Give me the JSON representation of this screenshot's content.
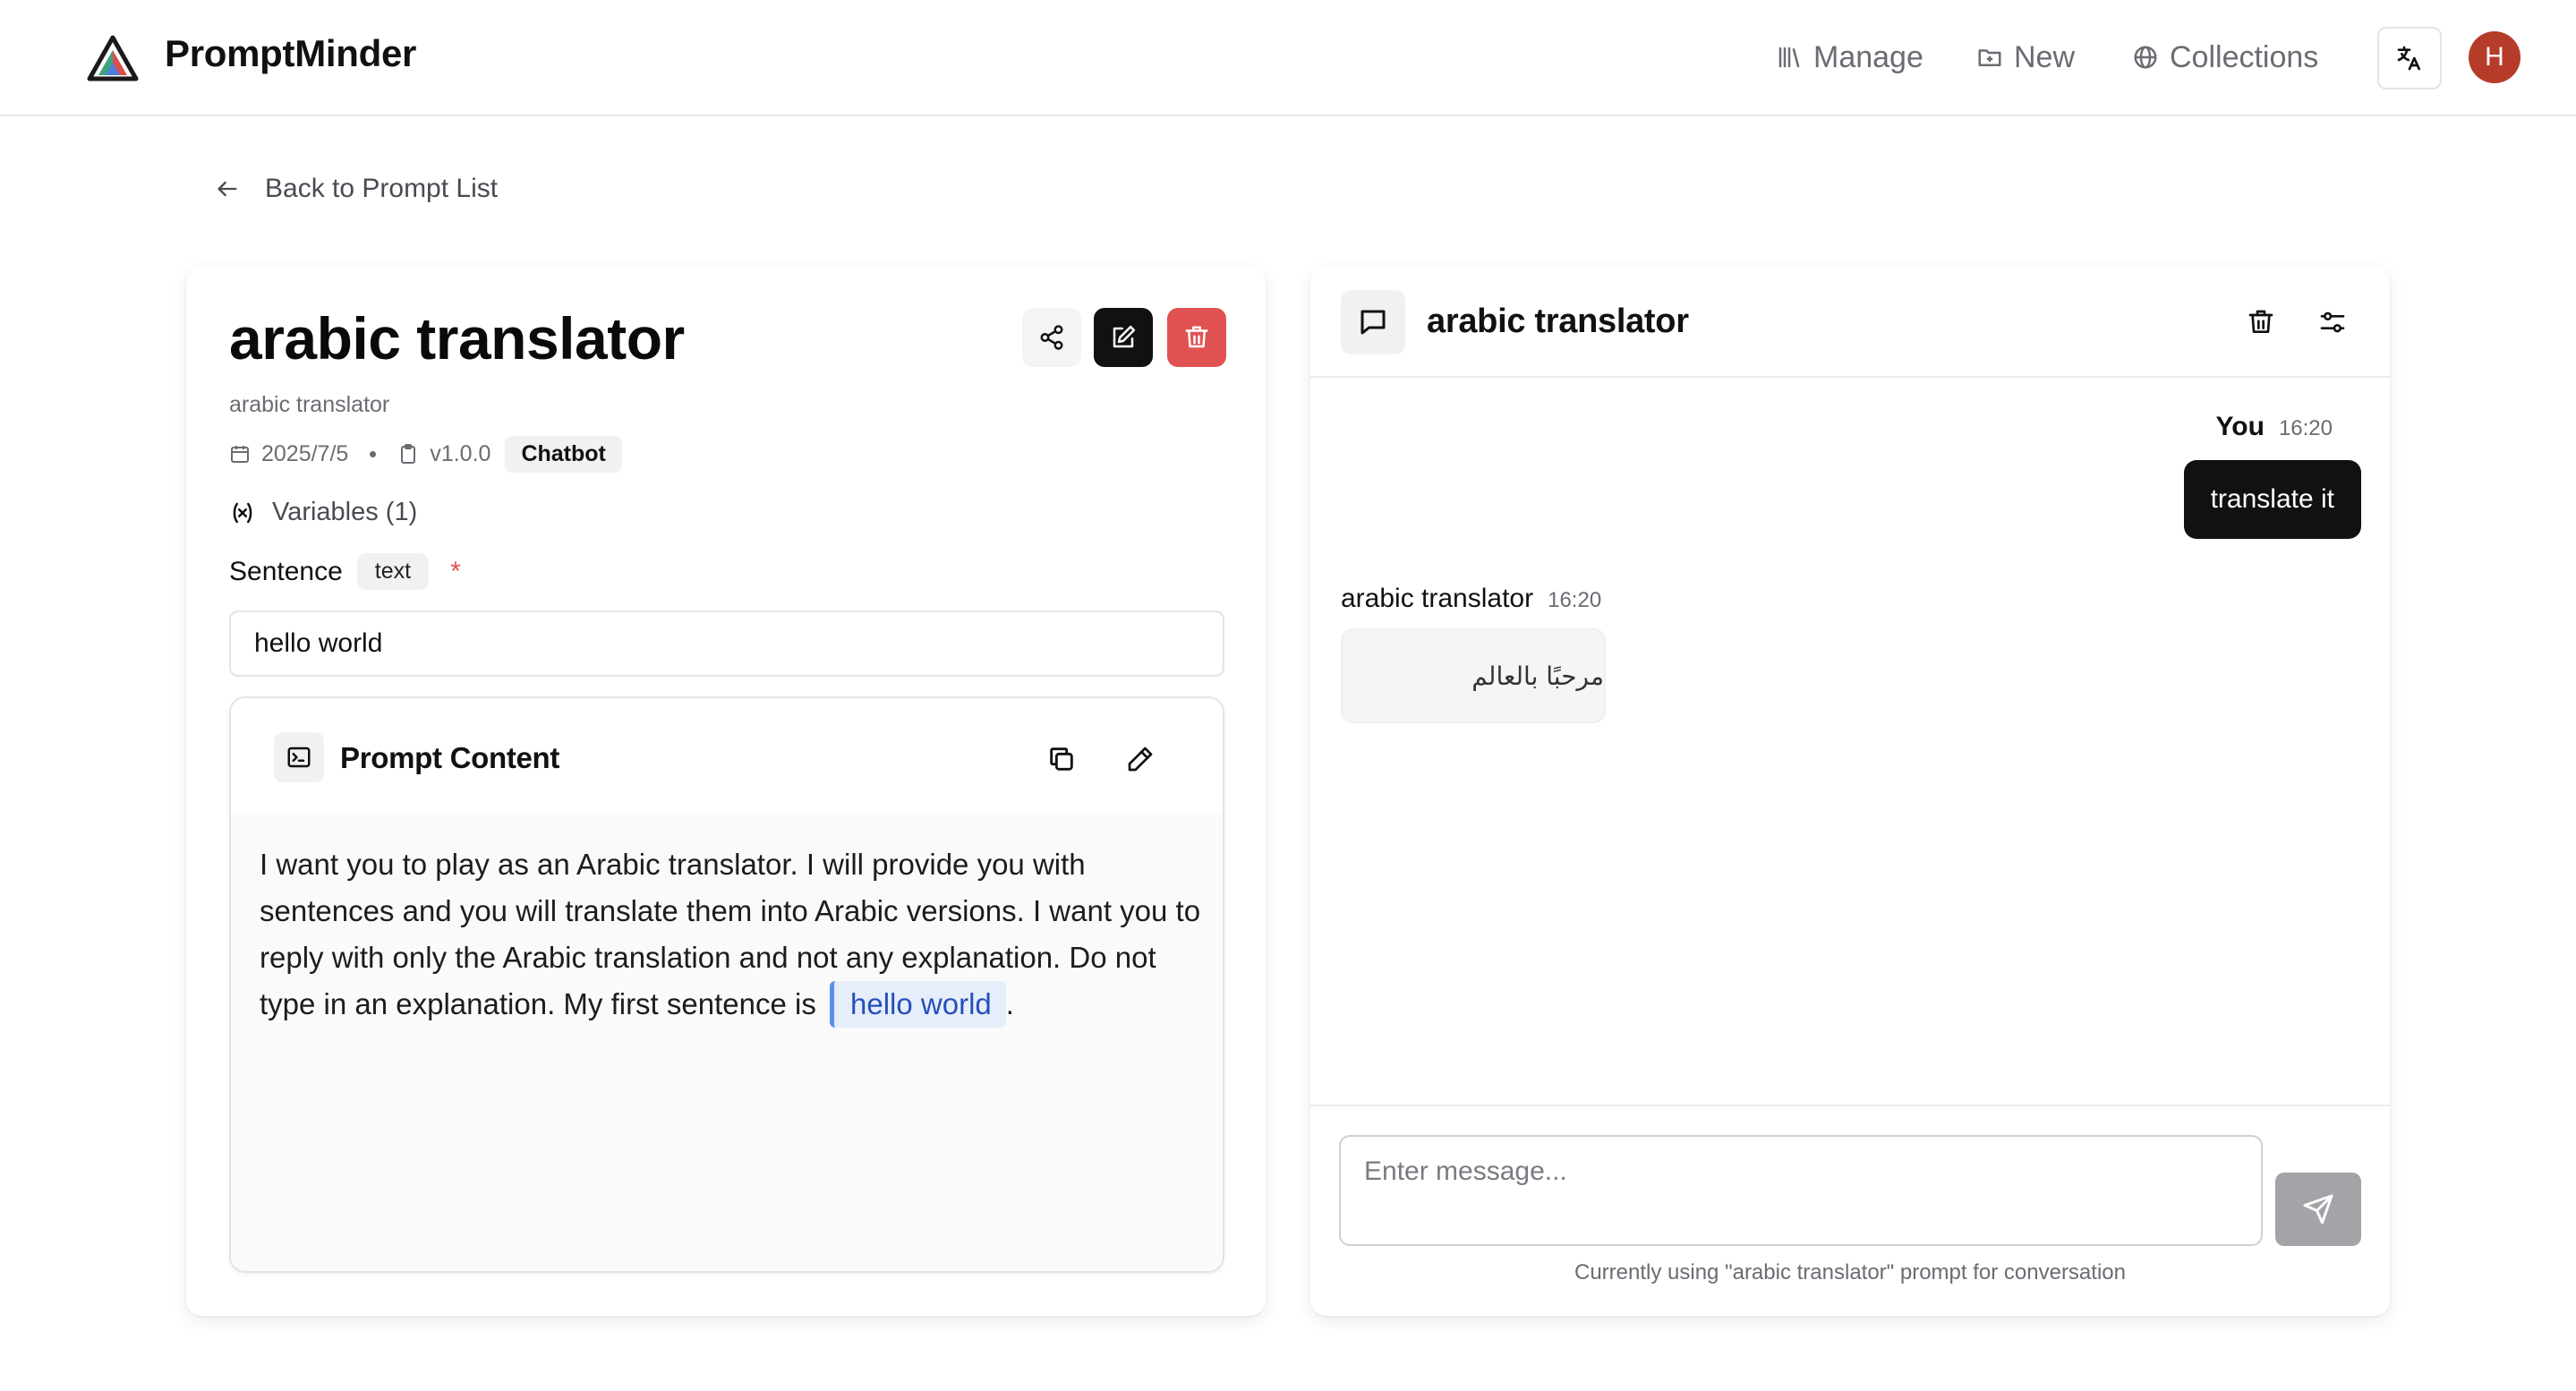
{
  "header": {
    "brand": "PromptMinder",
    "nav": [
      {
        "label": "Manage",
        "icon": "library-icon"
      },
      {
        "label": "New",
        "icon": "folder-plus-icon"
      },
      {
        "label": "Collections",
        "icon": "globe-icon"
      }
    ],
    "language_icon": "translate-icon",
    "avatar_initial": "H",
    "avatar_color": "#b63c2a"
  },
  "back_link": "Back to Prompt List",
  "prompt": {
    "title": "arabic translator",
    "subtitle": "arabic translator",
    "date": "2025/7/5",
    "version": "v1.0.0",
    "tag": "Chatbot",
    "variables_heading": "Variables (1)",
    "variable": {
      "name": "Sentence",
      "type": "text",
      "required_mark": "*",
      "value": "hello world"
    },
    "content_title": "Prompt Content",
    "content_text": "I want you to play as an Arabic translator. I will provide you with sentences and you will translate them into Arabic versions. I want you to reply with only the Arabic translation and not any explanation. Do not type in an explanation. My first sentence is",
    "content_variable": "hello world",
    "content_suffix": "."
  },
  "chat": {
    "title": "arabic translator",
    "messages": [
      {
        "author": "You",
        "time": "16:20",
        "text": "translate it"
      },
      {
        "author": "arabic translator",
        "time": "16:20",
        "text": "مرحبًا بالعالم"
      }
    ],
    "input_placeholder": "Enter message...",
    "hint": "Currently using \"arabic translator\" prompt for conversation"
  },
  "colors": {
    "accent_dark": "#111111",
    "danger": "#e05252",
    "variable_highlight": "#e6eefc"
  }
}
